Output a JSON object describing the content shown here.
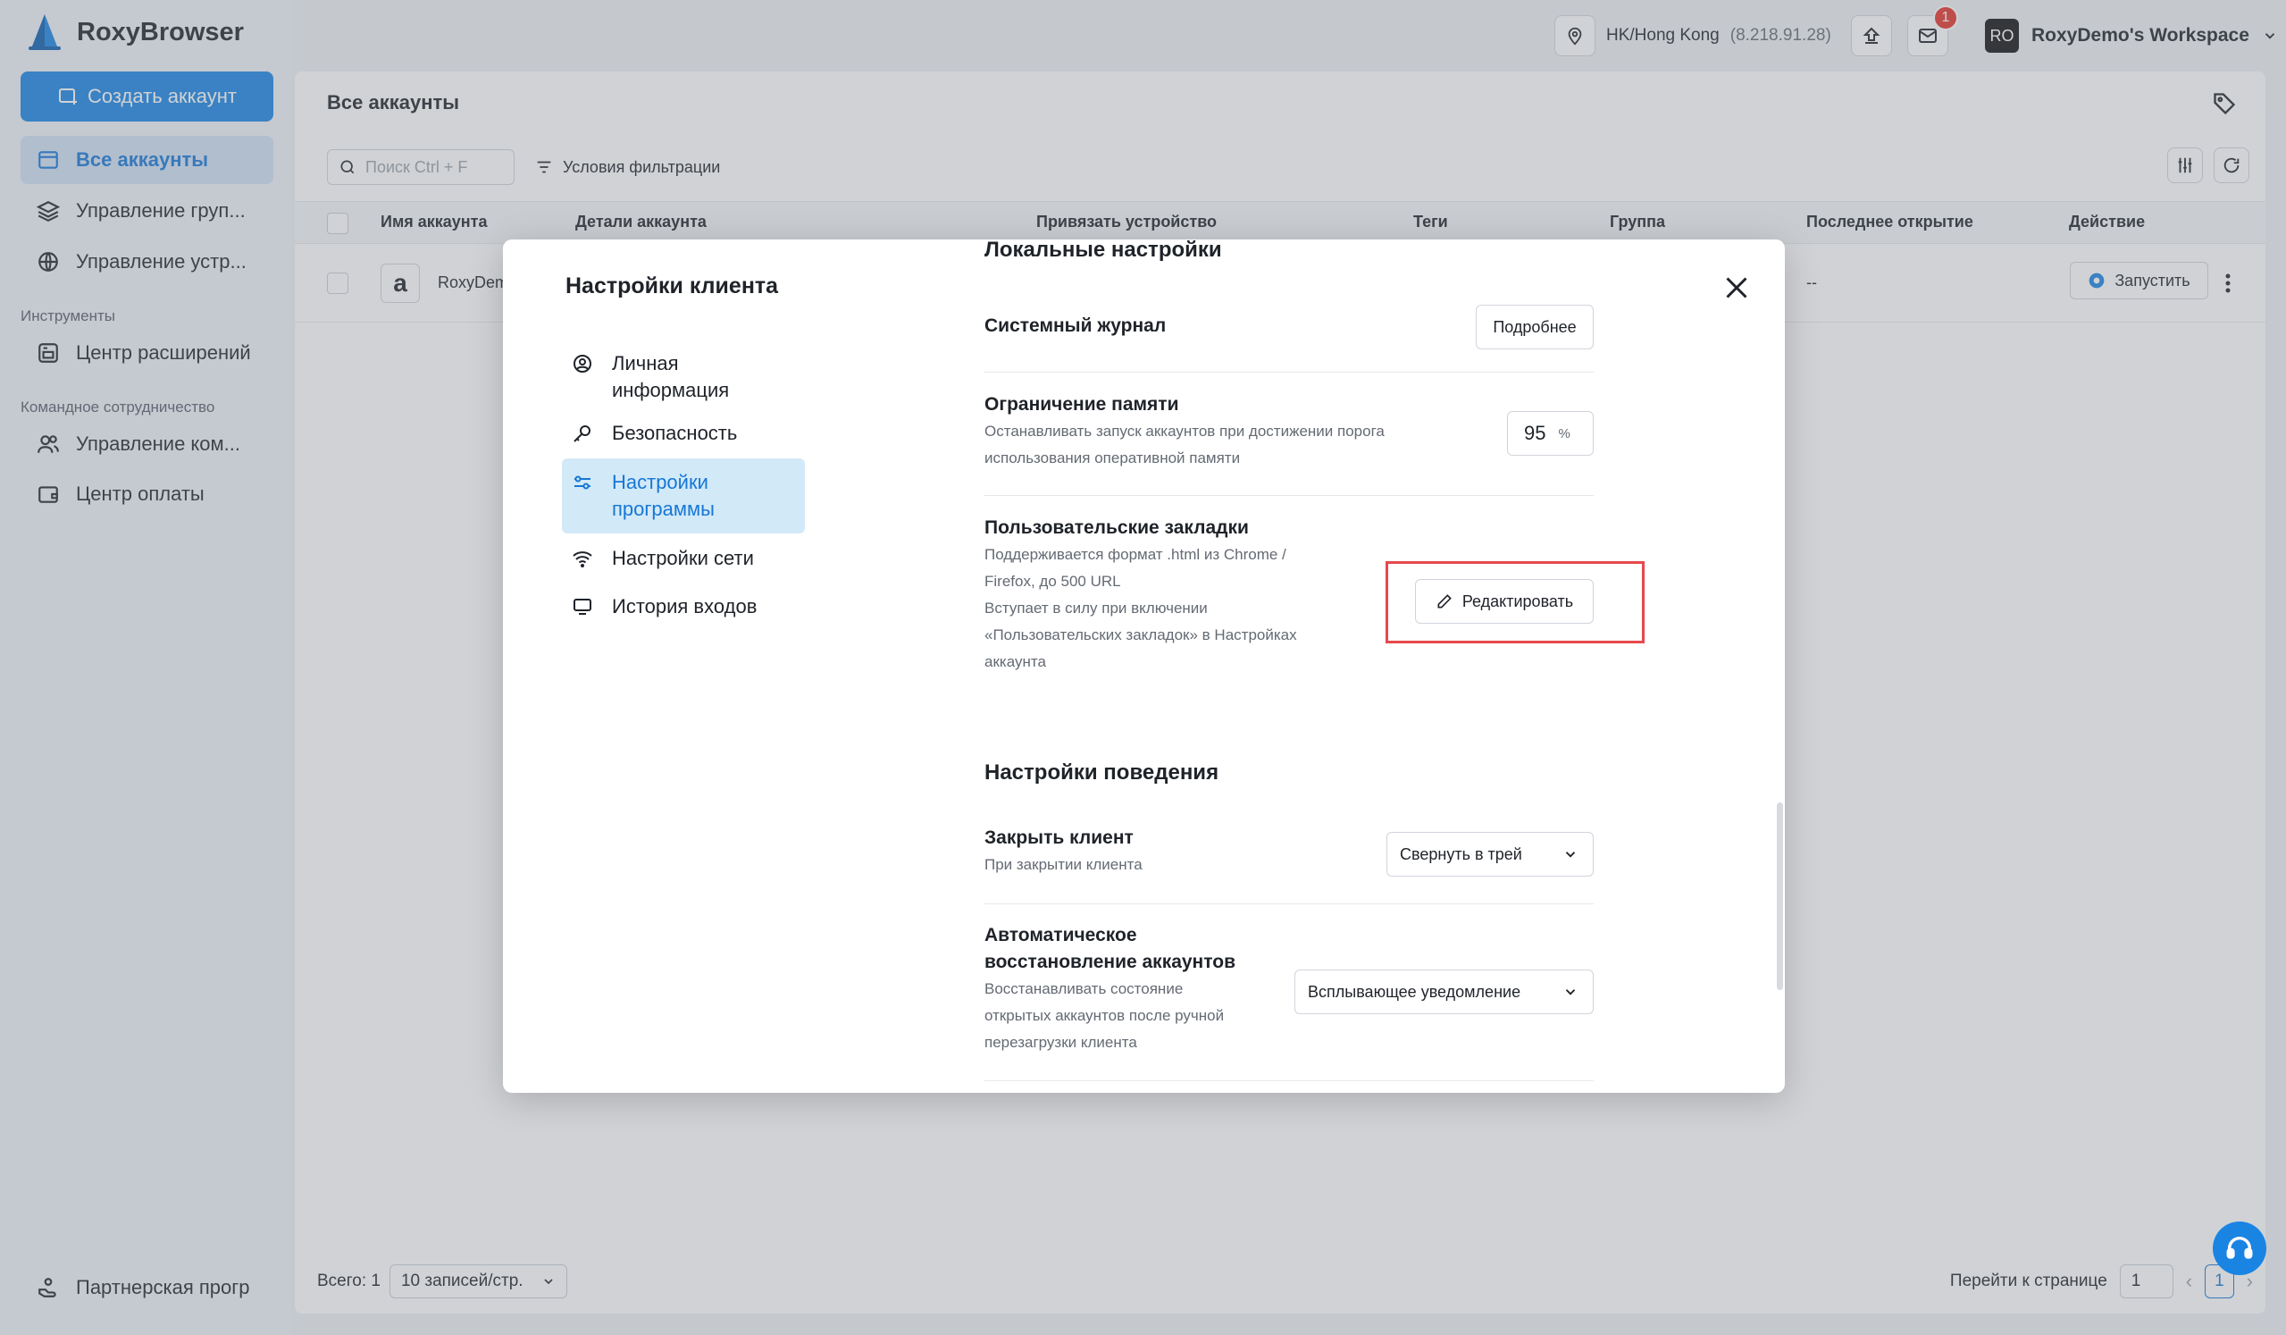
{
  "app": {
    "name": "RoxyBrowser"
  },
  "sidebar": {
    "create_label": "Создать аккаунт",
    "items": [
      {
        "label": "Все аккаунты"
      },
      {
        "label": "Управление груп..."
      },
      {
        "label": "Управление устр..."
      }
    ],
    "tools_section": "Инструменты",
    "tools_items": [
      {
        "label": "Центр расширений"
      }
    ],
    "team_section": "Командное сотрудничество",
    "team_items": [
      {
        "label": "Управление ком..."
      },
      {
        "label": "Центр оплаты"
      }
    ],
    "partner_label": "Партнерская прогр"
  },
  "topbar": {
    "location": "HK/Hong Kong",
    "ip": "(8.218.91.28)",
    "mail_badge": "1",
    "workspace_initials": "RO",
    "workspace_name": "RoxyDemo's Workspace"
  },
  "accounts": {
    "title": "Все аккаунты",
    "search_placeholder": "Поиск Ctrl + F",
    "filter_label": "Условия фильтрации",
    "columns": {
      "name": "Имя аккаунта",
      "details": "Детали аккаунта",
      "device": "Привязать устройство",
      "tags": "Теги",
      "group": "Группа",
      "last_open": "Последнее открытие",
      "action": "Действие"
    },
    "rows": [
      {
        "name": "RoxyDem",
        "last_open": "--",
        "action": "Запустить"
      }
    ],
    "footer": {
      "total": "Всего: 1",
      "per_page": "10 записей/стр.",
      "goto_label": "Перейти к странице",
      "goto_value": "1",
      "current_page": "1"
    }
  },
  "dialog": {
    "title": "Настройки клиента",
    "nav": [
      {
        "label": "Личная информация"
      },
      {
        "label": "Безопасность"
      },
      {
        "label": "Настройки программы"
      },
      {
        "label": "Настройки сети"
      },
      {
        "label": "История входов"
      }
    ],
    "local_section": "Локальные настройки",
    "system_log": {
      "title": "Системный журнал",
      "button": "Подробнее"
    },
    "memory_limit": {
      "title": "Ограничение памяти",
      "desc1": "Останавливать запуск аккаунтов при достижении порога",
      "desc2": "использования оперативной памяти",
      "value": "95",
      "unit": "%"
    },
    "bookmarks": {
      "title": "Пользовательские закладки",
      "desc1": "Поддерживается формат .html из Chrome /",
      "desc2": "Firefox, до 500 URL",
      "desc3": "Вступает в силу при включении",
      "desc4": "«Пользовательских закладок» в Настройках",
      "desc5": "аккаунта",
      "button": "Редактировать"
    },
    "behavior_section": "Настройки поведения",
    "close_client": {
      "title": "Закрыть клиент",
      "desc": "При закрытии клиента",
      "value": "Свернуть в трей"
    },
    "auto_restore": {
      "title1": "Автоматическое",
      "title2": "восстановление аккаунтов",
      "desc1": "Восстанавливать состояние",
      "desc2": "открытых аккаунтов после ручной",
      "desc3": "перезагрузки клиента",
      "value": "Всплывающее уведомление"
    }
  },
  "colors": {
    "accent": "#1a84e3",
    "highlight": "#e5494d",
    "active_nav_bg": "#d2e9f8"
  }
}
